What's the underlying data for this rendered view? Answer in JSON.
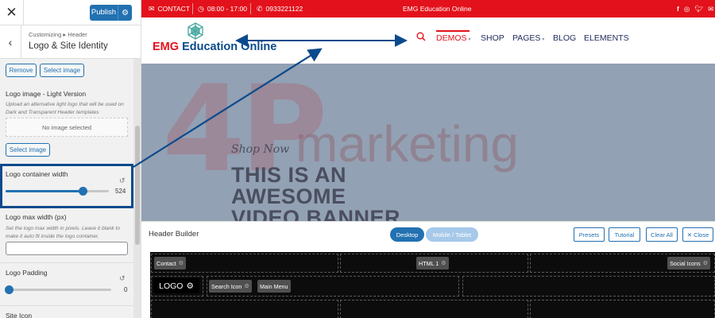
{
  "customizer": {
    "publish_label": "Publish",
    "breadcrumb": "Customizing ▸ Header",
    "section_title": "Logo & Site Identity",
    "remove_label": "Remove",
    "select_image_label": "Select image",
    "light_logo": {
      "label": "Logo image - Light Version",
      "description": "Upload an alternative light logo that will be used on Dark and Transparent Header templates",
      "empty_text": "No image selected",
      "select_label": "Select image"
    },
    "logo_container_width": {
      "label": "Logo container width",
      "value": "524",
      "fraction": 0.75
    },
    "logo_max_width": {
      "label": "Logo max width (px)",
      "description": "Set the logo max width in pixels. Leave it blank to make it auto fit inside the logo container.",
      "value": ""
    },
    "logo_padding": {
      "label": "Logo Padding",
      "value": "0",
      "fraction": 0
    },
    "site_icon_label": "Site Icon"
  },
  "topbar": {
    "contact": "CONTACT",
    "hours": "08:00 - 17:00",
    "phone": "0933221122",
    "site_name": "EMG Education Online",
    "socials": [
      "facebook-icon",
      "instagram-icon",
      "twitter-icon",
      "mail-icon"
    ]
  },
  "header": {
    "logo_emg": "EMG",
    "logo_rest": "Education Online",
    "nav": [
      {
        "label": "DEMOS",
        "active": true,
        "dropdown": true
      },
      {
        "label": "SHOP",
        "active": false,
        "dropdown": false
      },
      {
        "label": "PAGES",
        "active": false,
        "dropdown": true
      },
      {
        "label": "BLOG",
        "active": false,
        "dropdown": false
      },
      {
        "label": "ELEMENTS",
        "active": false,
        "dropdown": false
      }
    ]
  },
  "hero": {
    "watermark_mark": "4P",
    "watermark_text": "marketing",
    "kicker": "Shop Now",
    "line1": "THIS IS AN",
    "line2": "AWESOME",
    "line3": "VIDEO BANNER"
  },
  "builder": {
    "title": "Header Builder",
    "tab_desktop": "Desktop",
    "tab_mobile": "Mobile / Tablet",
    "presets": "Presets",
    "tutorial": "Tutorial",
    "clear_all": "Clear All",
    "close": "✕ Close",
    "row1": {
      "contact": "Contact",
      "html": "HTML 1",
      "social": "Social Icons"
    },
    "row2": {
      "logo": "LOGO",
      "search": "Search Icon",
      "main_menu": "Main Menu"
    }
  },
  "colors": {
    "accent_red": "#e3111b",
    "brand_blue": "#0b4a8c",
    "wp_blue": "#2271b1"
  }
}
